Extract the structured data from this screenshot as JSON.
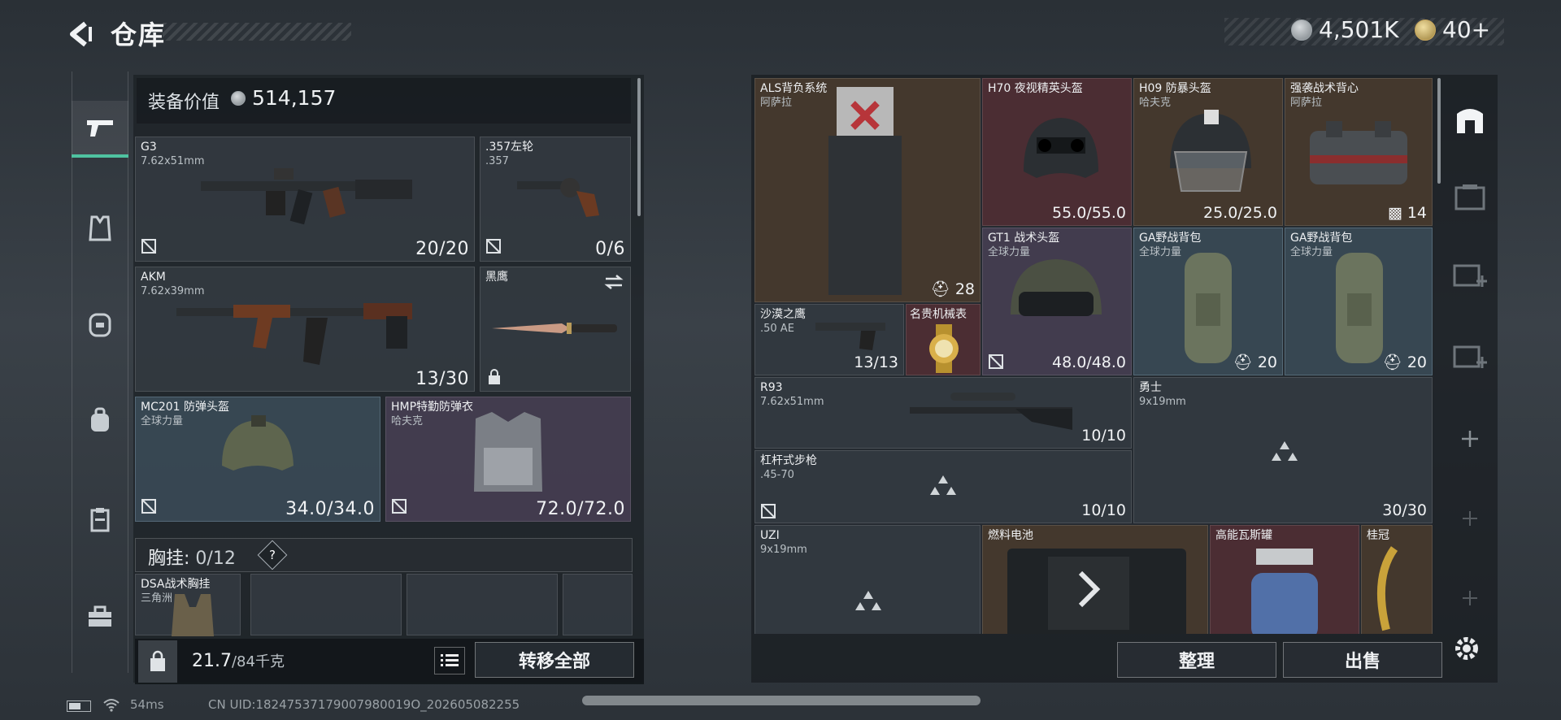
{
  "header": {
    "title": "仓库"
  },
  "currency": {
    "silver": "4,501K",
    "gold": "40+"
  },
  "left_tabs": [
    "pistol-icon",
    "vest-icon",
    "helmet-icon",
    "backpack-icon",
    "clipboard-icon",
    "toolbox-icon"
  ],
  "equipment": {
    "value_label": "装备价值",
    "value": "514,157",
    "slots": [
      {
        "name": "G3",
        "sub": "7.62x51mm",
        "count": "20/20"
      },
      {
        "name": ".357左轮",
        "sub": ".357",
        "count": "0/6"
      },
      {
        "name": "AKM",
        "sub": "7.62x39mm",
        "count": "13/30"
      },
      {
        "name": "黑鹰",
        "sub": "",
        "count": ""
      },
      {
        "name": "MC201 防弹头盔",
        "sub": "全球力量",
        "count": "34.0/34.0"
      },
      {
        "name": "HMP特勤防弹衣",
        "sub": "哈夫克",
        "count": "72.0/72.0"
      }
    ],
    "chest_rig_label": "胸挂:",
    "chest_rig_count": "0/12",
    "help": "?",
    "rig_item": {
      "name": "DSA战术胸挂",
      "sub": "三角洲"
    },
    "weight": "21.7",
    "weight_max": "/84千克",
    "transfer_all": "转移全部"
  },
  "storage": {
    "items": [
      {
        "name": "ALS背负系统",
        "sub": "阿萨拉",
        "count": "28"
      },
      {
        "name": "H70 夜视精英头盔",
        "sub": "",
        "count": "55.0/55.0"
      },
      {
        "name": "H09 防暴头盔",
        "sub": "哈夫克",
        "count": "25.0/25.0"
      },
      {
        "name": "强袭战术背心",
        "sub": "阿萨拉",
        "count": "14"
      },
      {
        "name": "GT1 战术头盔",
        "sub": "全球力量",
        "count": "48.0/48.0"
      },
      {
        "name": "GA野战背包",
        "sub": "全球力量",
        "count": "20"
      },
      {
        "name": "GA野战背包",
        "sub": "全球力量",
        "count": "20"
      },
      {
        "name": "沙漠之鹰",
        "sub": ".50 AE",
        "count": "13/13"
      },
      {
        "name": "名贵机械表",
        "sub": "",
        "count": ""
      },
      {
        "name": "R93",
        "sub": "7.62x51mm",
        "count": "10/10"
      },
      {
        "name": "勇士",
        "sub": "9x19mm",
        "count": "30/30"
      },
      {
        "name": "杠杆式步枪",
        "sub": ".45-70",
        "count": "10/10"
      },
      {
        "name": "UZI",
        "sub": "9x19mm",
        "count": ""
      },
      {
        "name": "燃料电池",
        "sub": "",
        "count": ""
      },
      {
        "name": "高能瓦斯罐",
        "sub": "",
        "count": ""
      },
      {
        "name": "桂冠",
        "sub": "",
        "count": ""
      }
    ],
    "sort_label": "整理",
    "sell_label": "出售"
  },
  "status": {
    "ping": "54ms",
    "uid": "CN UID:18247537179007980019O_202605082255"
  }
}
